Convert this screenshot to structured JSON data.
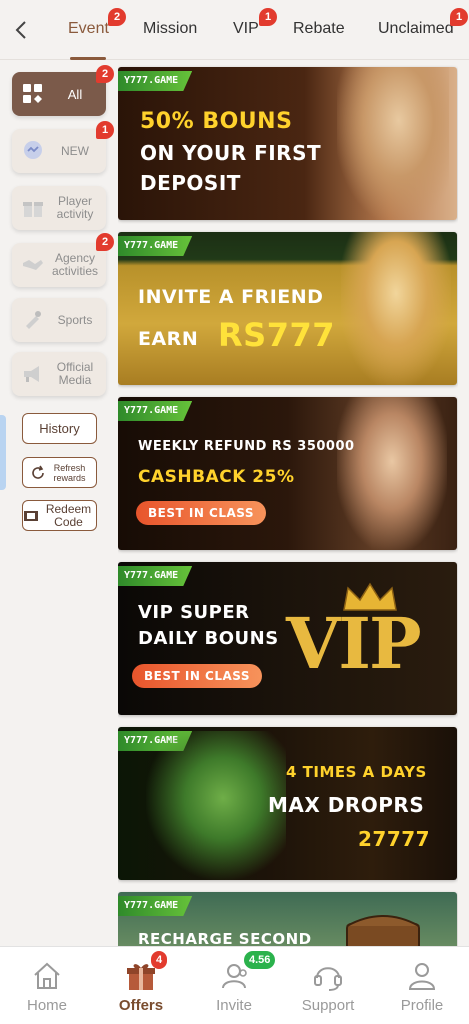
{
  "tabs": [
    {
      "label": "Event",
      "badge": "2"
    },
    {
      "label": "Mission",
      "badge": ""
    },
    {
      "label": "VIP",
      "badge": "1"
    },
    {
      "label": "Rebate",
      "badge": ""
    },
    {
      "label": "Unclaimed",
      "badge": "1"
    }
  ],
  "sidebar": {
    "items": [
      {
        "label": "All",
        "badge": "2"
      },
      {
        "label": "NEW",
        "badge": "1"
      },
      {
        "label": "Player activity",
        "badge": ""
      },
      {
        "label": "Agency activities",
        "badge": "2"
      },
      {
        "label": "Sports",
        "badge": ""
      },
      {
        "label": "Official Media",
        "badge": ""
      }
    ],
    "history_label": "History",
    "refresh_label": "Refresh rewards",
    "redeem_label": "Redeem Code"
  },
  "banners": [
    {
      "brand": "Y777.GAME",
      "lines": [
        "50% BOUNS",
        "ON YOUR FIRST",
        "DEPOSIT"
      ]
    },
    {
      "brand": "Y777.GAME",
      "lines": [
        "INVITE A FRIEND",
        "EARN",
        "RS777"
      ]
    },
    {
      "brand": "Y777.GAME",
      "lines": [
        "WEEKLY REFUND RS 350000",
        "CASHBACK 25%"
      ],
      "pill": "BEST IN CLASS"
    },
    {
      "brand": "Y777.GAME",
      "lines": [
        "VIP SUPER",
        "DAILY BOUNS",
        "VIP"
      ],
      "pill": "BEST IN CLASS"
    },
    {
      "brand": "Y777.GAME",
      "lines": [
        "4 TIMES A DAYS",
        "MAX DROPRS",
        "27777"
      ]
    },
    {
      "brand": "Y777.GAME",
      "lines": [
        "RECHARGE SECOND"
      ]
    }
  ],
  "bottom_nav": [
    {
      "label": "Home",
      "badge": ""
    },
    {
      "label": "Offers",
      "badge": "4"
    },
    {
      "label": "Invite",
      "badge": "4.56"
    },
    {
      "label": "Support",
      "badge": ""
    },
    {
      "label": "Profile",
      "badge": ""
    }
  ],
  "colors": {
    "accent": "#8a5a3c",
    "badge": "#e23b2e",
    "active_side": "#7b5a4a",
    "green_badge": "#2bb24c"
  },
  "icons": [
    "back-arrow-icon",
    "all-grid-icon",
    "chat-bubble-icon",
    "gift-box-icon",
    "handshake-icon",
    "sports-icon",
    "megaphone-icon",
    "refresh-icon",
    "ticket-icon",
    "home-icon",
    "gift-icon",
    "users-icon",
    "headset-icon",
    "person-icon"
  ]
}
